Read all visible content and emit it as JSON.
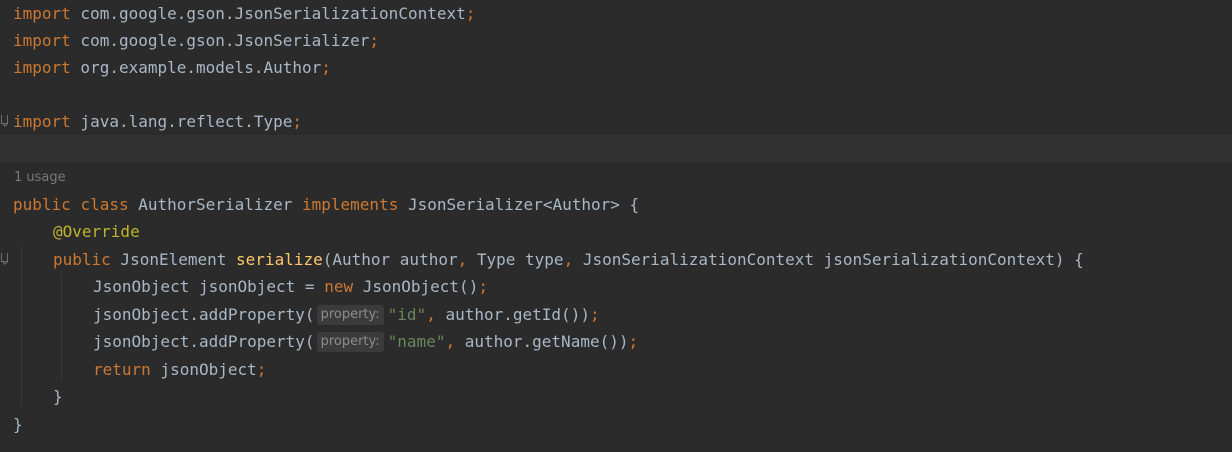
{
  "editor": {
    "usage_hint": "1 usage",
    "param_hint": "property:",
    "lines": {
      "l1": {
        "kw": "import",
        "text": " com.google.gson.JsonSerializationContext",
        "semi": ";"
      },
      "l2": {
        "kw": "import",
        "text": " com.google.gson.JsonSerializer",
        "semi": ";"
      },
      "l3": {
        "kw": "import",
        "text": " org.example.models.Author",
        "semi": ";"
      },
      "l5": {
        "kw": "import",
        "text": " java.lang.reflect.Type",
        "semi": ";"
      },
      "l7": {
        "kw1": "public",
        "kw2": "class",
        "name": " AuthorSerializer ",
        "kw3": "implements",
        "text": " JsonSerializer<Author> {"
      },
      "l8": {
        "ann": "@Override"
      },
      "l9": {
        "kw": "public",
        "t1": " JsonElement ",
        "fn": "serialize",
        "t2": "(Author author",
        "c1": ",",
        "t3": " Type type",
        "c2": ",",
        "t4": " JsonSerializationContext jsonSerializationContext) {"
      },
      "l10": {
        "t1": "JsonObject jsonObject = ",
        "kw": "new",
        "t2": " JsonObject()",
        "semi": ";"
      },
      "l11": {
        "t1": "jsonObject.addProperty(",
        "str": "\"id\"",
        "c": ",",
        "t2": " author.getId())",
        "semi": ";"
      },
      "l12": {
        "t1": "jsonObject.addProperty(",
        "str": "\"name\"",
        "c": ",",
        "t2": " author.getName())",
        "semi": ";"
      },
      "l13": {
        "kw": "return",
        "t1": " jsonObject",
        "semi": ";"
      },
      "l14": {
        "text": "}"
      },
      "l15": {
        "text": "}"
      }
    }
  }
}
